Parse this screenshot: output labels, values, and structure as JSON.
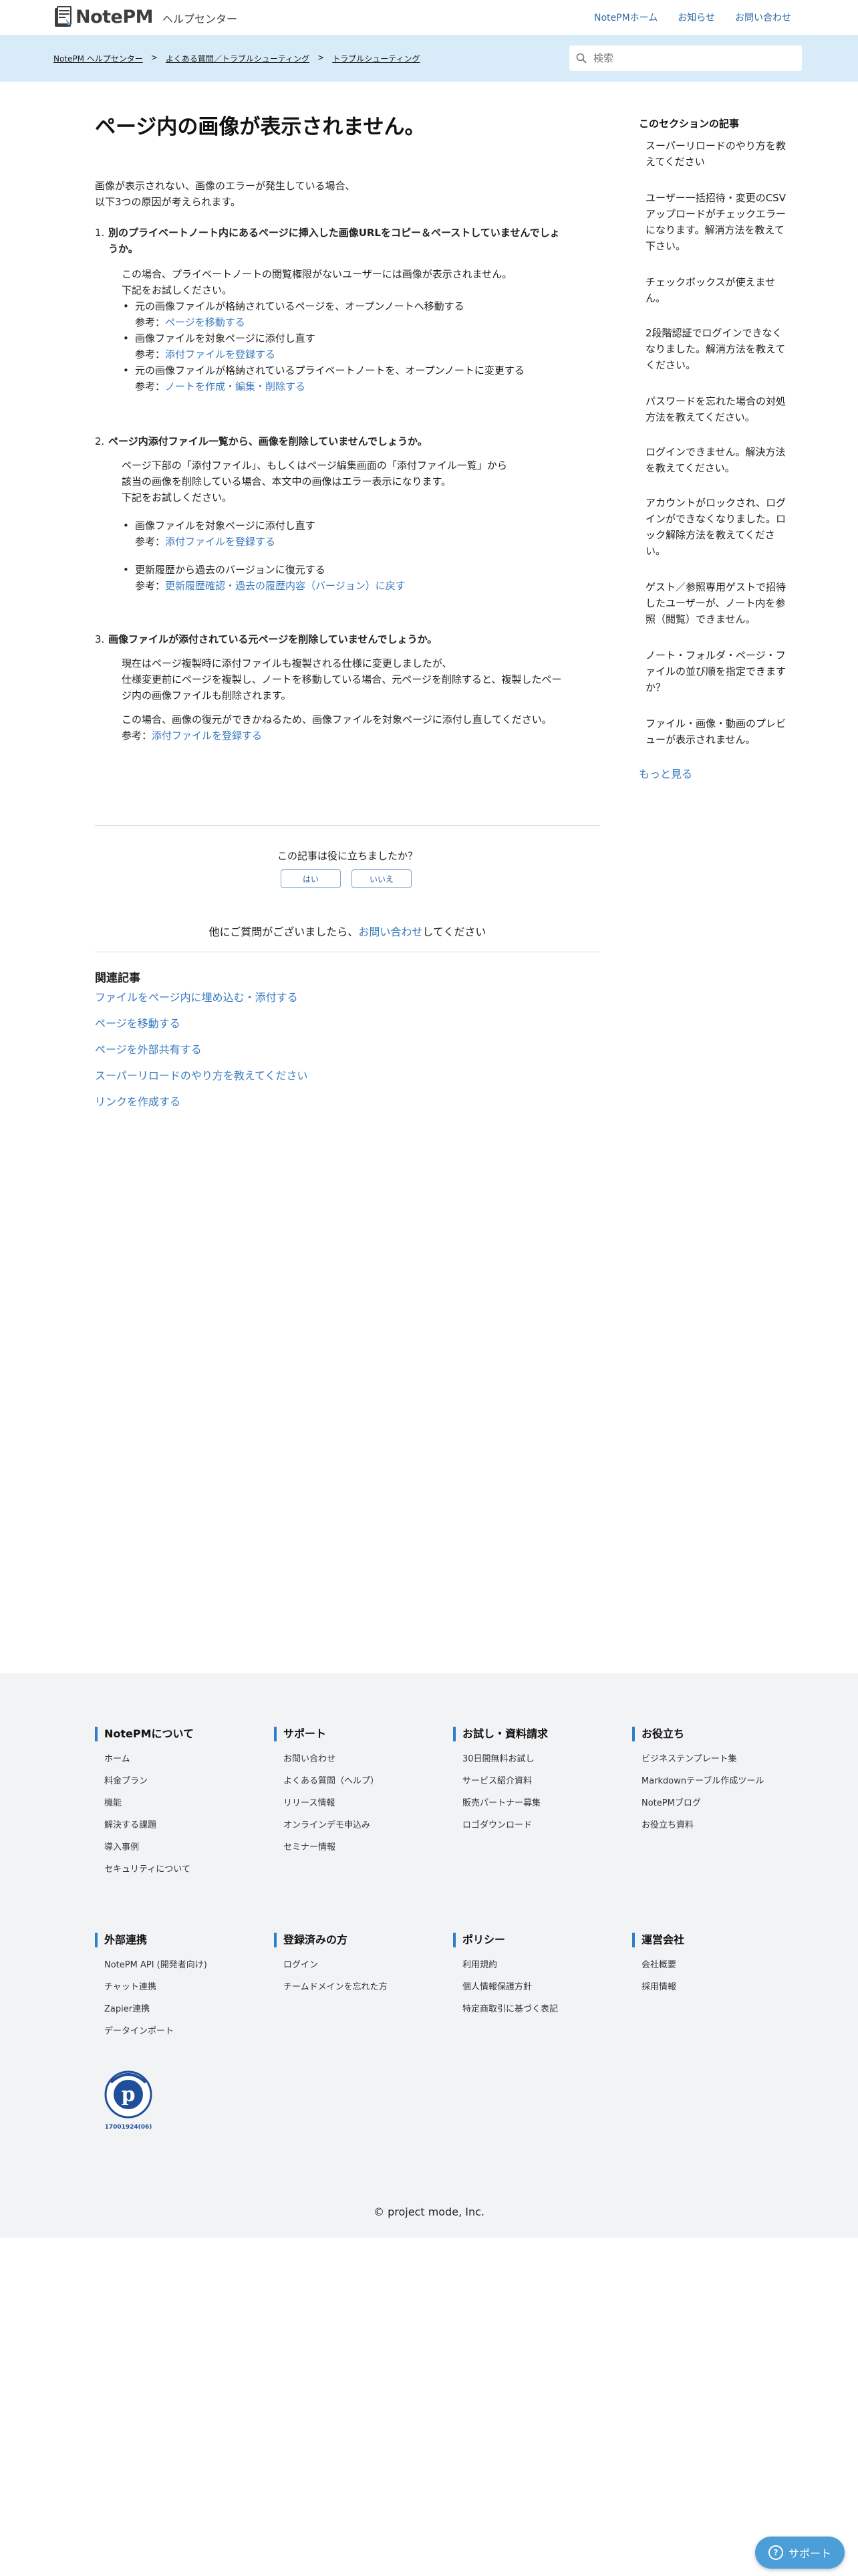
{
  "header": {
    "logo_text": "NotePM",
    "logo_sub": "ヘルプセンター",
    "nav": [
      "NotePMホーム",
      "お知らせ",
      "お問い合わせ"
    ]
  },
  "breadcrumb": [
    "NotePM ヘルプセンター",
    "よくある質問／トラブルシューティング",
    "トラブルシューティング"
  ],
  "breadcrumb_sep": ">",
  "search": {
    "placeholder": "検索"
  },
  "article": {
    "title": "ページ内の画像が表示されません。",
    "intro": [
      "画像が表示されない、画像のエラーが発生している場合、",
      "以下3つの原因が考えられます。"
    ],
    "sections": [
      {
        "num": "1.",
        "heading": [
          "別のプライベートノート内にあるページに挿入した画像URLをコピー＆ペーストしていませんでしょ",
          "うか。"
        ],
        "para": [
          "この場合、プライベートノートの閲覧権限がないユーザーには画像が表示されません。",
          "下記をお試しください。"
        ],
        "items": [
          {
            "text": "元の画像ファイルが格納されているページを、オープンノートへ移動する",
            "ref_prefix": "参考：",
            "ref": "ページを移動する"
          },
          {
            "text": "画像ファイルを対象ページに添付し直す",
            "ref_prefix": "参考：",
            "ref": "添付ファイルを登録する"
          },
          {
            "text": "元の画像ファイルが格納されているプライベートノートを、オープンノートに変更する",
            "ref_prefix": "参考：",
            "ref": "ノートを作成・編集・削除する"
          }
        ]
      },
      {
        "num": "2.",
        "heading": [
          "ページ内添付ファイル一覧から、画像を削除していませんでしょうか。"
        ],
        "para": [
          "ページ下部の「添付ファイル」、もしくはページ編集画面の「添付ファイル一覧」から",
          "該当の画像を削除している場合、本文中の画像はエラー表示になります。",
          "下記をお試しください。"
        ],
        "items": [
          {
            "text": "画像ファイルを対象ページに添付し直す",
            "ref_prefix": "参考：",
            "ref": "添付ファイルを登録する"
          },
          {
            "text": "更新履歴から過去のバージョンに復元する",
            "ref_prefix": "参考：",
            "ref": "更新履歴確認・過去の履歴内容（バージョン）に戻す"
          }
        ]
      },
      {
        "num": "3.",
        "heading": [
          "画像ファイルが添付されている元ページを削除していませんでしょうか。"
        ],
        "para": [
          "現在はページ複製時に添付ファイルも複製される仕様に変更しましたが、",
          "仕様変更前にページを複製し、ノートを移動している場合、元ページを削除すると、複製したペー",
          "ジ内の画像ファイルも削除されます。"
        ],
        "para2": "この場合、画像の復元ができかねるため、画像ファイルを対象ページに添付し直してください。",
        "ref_prefix": "参考：",
        "ref": "添付ファイルを登録する"
      }
    ]
  },
  "feedback": {
    "question": "この記事は役に立ちましたか？",
    "yes": "はい",
    "no": "いいえ"
  },
  "contact": {
    "prefix": "他にご質問がございましたら、",
    "link": "お問い合わせ",
    "suffix": "してください"
  },
  "related": {
    "heading": "関連記事",
    "items": [
      "ファイルをページ内に埋め込む・添付する",
      "ページを移動する",
      "ページを外部共有する",
      "スーパーリロードのやり方を教えてください",
      "リンクを作成する"
    ]
  },
  "sidebar": {
    "heading": "このセクションの記事",
    "items": [
      [
        "スーパーリロードのやり方を教",
        "えてください"
      ],
      [
        "ユーザー一括招待・変更のCSV",
        "アップロードがチェックエラー",
        "になります。解消方法を教えて",
        "下さい。"
      ],
      [
        "チェックボックスが使えませ",
        "ん。"
      ],
      [
        "2段階認証でログインできなく",
        "なりました。解消方法を教えて",
        "ください。"
      ],
      [
        "パスワードを忘れた場合の対処",
        "方法を教えてください。"
      ],
      [
        "ログインできません。解決方法",
        "を教えてください。"
      ],
      [
        "アカウントがロックされ、ログ",
        "インができなくなりました。ロ",
        "ック解除方法を教えてくださ",
        "い。"
      ],
      [
        "ゲスト／参照専用ゲストで招待",
        "したユーザーが、ノート内を参",
        "照（閲覧）できません。"
      ],
      [
        "ノート・フォルダ・ページ・フ",
        "ァイルの並び順を指定できます",
        "か？"
      ],
      [
        "ファイル・画像・動画のプレビ",
        "ューが表示されません。"
      ]
    ],
    "more": "もっと見る"
  },
  "footer": {
    "columns": [
      {
        "heading": "NotePMについて",
        "items": [
          "ホーム",
          "料金プラン",
          "機能",
          "解決する課題",
          "導入事例",
          "セキュリティについて"
        ]
      },
      {
        "heading": "サポート",
        "items": [
          "お問い合わせ",
          "よくある質問（ヘルプ）",
          "リリース情報",
          "オンラインデモ申込み",
          "セミナー情報"
        ]
      },
      {
        "heading": "お試し・資料請求",
        "items": [
          "30日間無料お試し",
          "サービス紹介資料",
          "販売パートナー募集",
          "ロゴダウンロード"
        ]
      },
      {
        "heading": "お役立ち",
        "items": [
          "ビジネステンプレート集",
          "Markdownテーブル作成ツール",
          "NotePMブログ",
          "お役立ち資料"
        ]
      },
      {
        "heading": "外部連携",
        "items": [
          "NotePM API (開発者向け)",
          "チャット連携",
          "Zapier連携",
          "データインポート"
        ]
      },
      {
        "heading": "登録済みの方",
        "items": [
          "ログイン",
          "チームドメインを忘れた方"
        ]
      },
      {
        "heading": "ポリシー",
        "items": [
          "利用規約",
          "個人情報保護方針",
          "特定商取引に基づく表記"
        ]
      },
      {
        "heading": "運営会社",
        "items": [
          "会社概要",
          "採用情報"
        ]
      }
    ],
    "privacy_mark": "17001924(06)",
    "copyright": "© project mode, Inc."
  },
  "support_button": "サポート",
  "colors": {
    "accent": "#2d7fc9",
    "link": "#3a7bbf",
    "band": "#d7ebf8",
    "footer_bg": "#f2f3f5",
    "support": "#4c9ed9"
  }
}
